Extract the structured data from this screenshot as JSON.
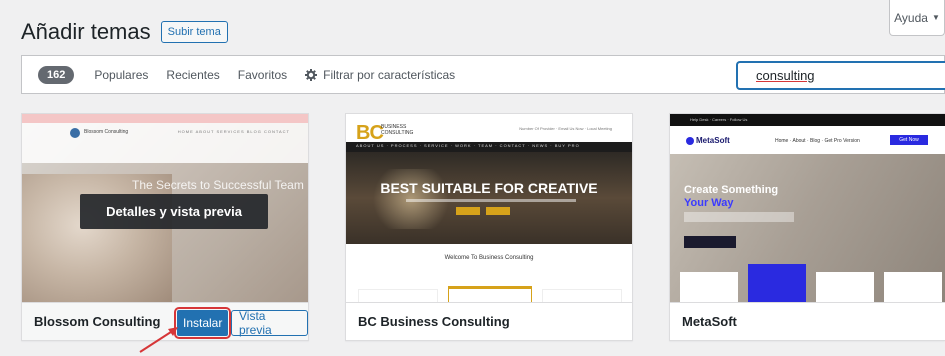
{
  "help": {
    "label": "Ayuda"
  },
  "header": {
    "title": "Añadir temas",
    "upload_label": "Subir tema"
  },
  "filter": {
    "count": "162",
    "links": [
      "Populares",
      "Recientes",
      "Favoritos"
    ],
    "feature_filter_label": "Filtrar por características",
    "search_value": "consulting"
  },
  "themes": [
    {
      "name": "Blossom Consulting",
      "overlay_label": "Detalles y vista previa",
      "install_label": "Instalar",
      "preview_label": "Vista previa",
      "hero_text": "The Secrets to Successful Team"
    },
    {
      "name": "BC Business Consulting",
      "hero_title": "BEST SUITABLE FOR CREATIVE",
      "welcome": "Welcome To Business Consulting"
    },
    {
      "name": "MetaSoft",
      "hero_title_a": "Create Something",
      "hero_title_b": "Your Way"
    }
  ],
  "colors": {
    "accent": "#2271b1",
    "highlight": "#d63638"
  }
}
